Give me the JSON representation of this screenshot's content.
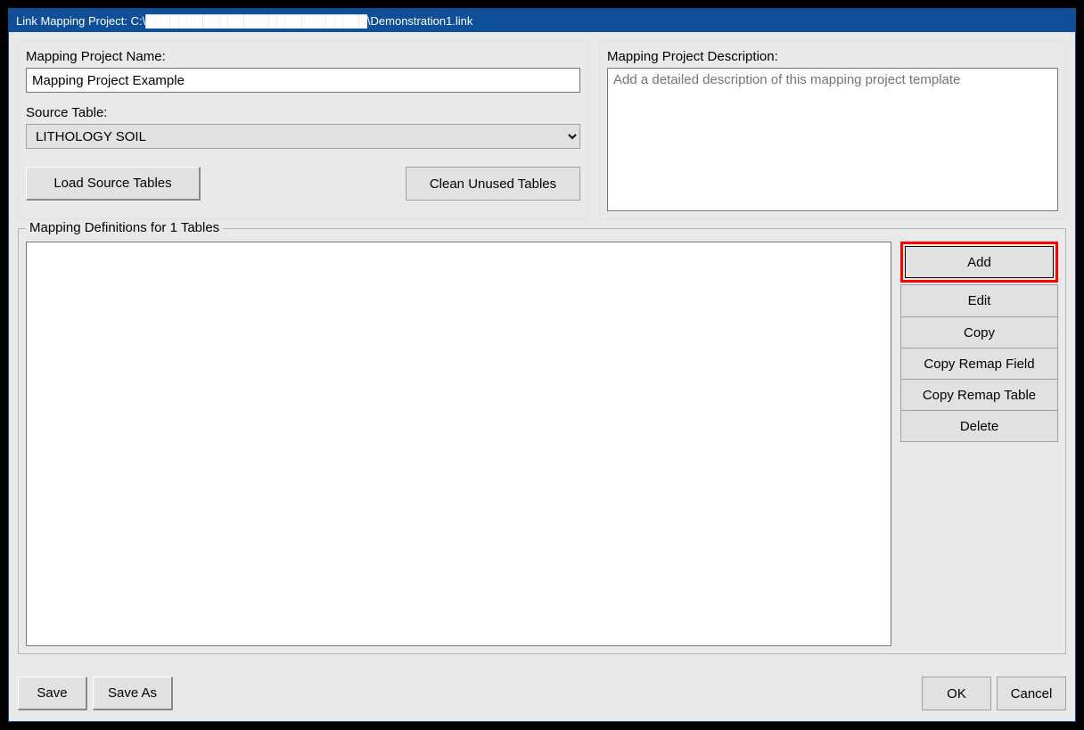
{
  "window": {
    "title": "Link Mapping Project:  C:\\███████████████████████████\\Demonstration1.link"
  },
  "left": {
    "name_label": "Mapping Project Name:",
    "name_value": "Mapping Project Example",
    "source_label": "Source Table:",
    "source_value": "LITHOLOGY SOIL",
    "load_button": "Load Source Tables",
    "clean_button": "Clean Unused Tables"
  },
  "right": {
    "desc_label": "Mapping Project Description:",
    "desc_placeholder": "Add a detailed description of this mapping project template"
  },
  "defs": {
    "legend": "Mapping Definitions for 1 Tables",
    "buttons": {
      "add": "Add",
      "edit": "Edit",
      "copy": "Copy",
      "copy_remap_field": "Copy Remap Field",
      "copy_remap_table": "Copy Remap Table",
      "delete": "Delete"
    }
  },
  "bottom": {
    "save": "Save",
    "save_as": "Save As",
    "ok": "OK",
    "cancel": "Cancel"
  }
}
